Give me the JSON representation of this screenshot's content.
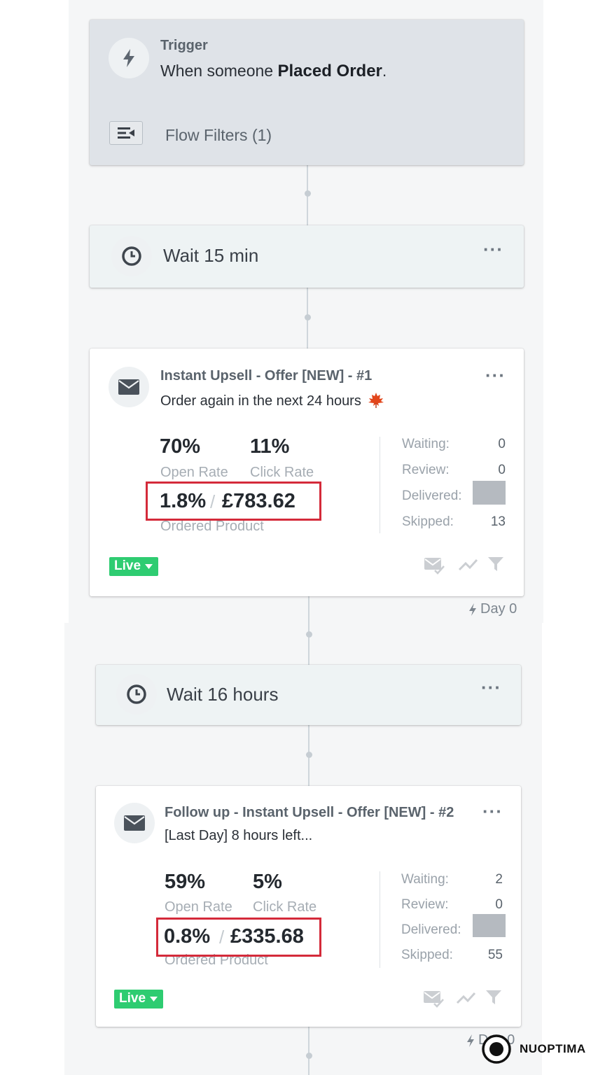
{
  "trigger": {
    "label": "Trigger",
    "text_prefix": "When someone",
    "event": "Placed Order",
    "text_suffix": ".",
    "filters": "Flow Filters (1)"
  },
  "wait1": {
    "label": "Wait 15 min"
  },
  "email1": {
    "name": "Instant Upsell - Offer [NEW] - #1",
    "subject": "Order again in the next 24 hours",
    "open_rate": "70%",
    "open_label": "Open Rate",
    "click_rate": "11%",
    "click_label": "Click Rate",
    "conv_rate": "1.8%",
    "conv_sep": "/",
    "revenue": "£783.62",
    "conv_label": "Ordered Product",
    "stats": [
      {
        "label": "Waiting:",
        "value": "0"
      },
      {
        "label": "Review:",
        "value": "0"
      },
      {
        "label": "Delivered:",
        "value": ""
      },
      {
        "label": "Skipped:",
        "value": "13"
      }
    ],
    "status": "Live",
    "day": "Day 0"
  },
  "wait2": {
    "label": "Wait 16 hours"
  },
  "email2": {
    "name": "Follow up - Instant Upsell - Offer [NEW] - #2",
    "subject": "[Last Day] 8 hours left...",
    "open_rate": "59%",
    "open_label": "Open Rate",
    "click_rate": "5%",
    "click_label": "Click Rate",
    "conv_rate": "0.8%",
    "conv_sep": "/",
    "revenue": "£335.68",
    "conv_label": "Ordered Product",
    "stats": [
      {
        "label": "Waiting:",
        "value": "2"
      },
      {
        "label": "Review:",
        "value": "0"
      },
      {
        "label": "Delivered:",
        "value": ""
      },
      {
        "label": "Skipped:",
        "value": "55"
      }
    ],
    "status": "Live",
    "day": "Day 0"
  },
  "brand": {
    "name": "NUOPTIMA"
  },
  "colors": {
    "live": "#2ecc71",
    "highlight": "#d42a3a",
    "trigger_bg": "#dfe3e8"
  }
}
